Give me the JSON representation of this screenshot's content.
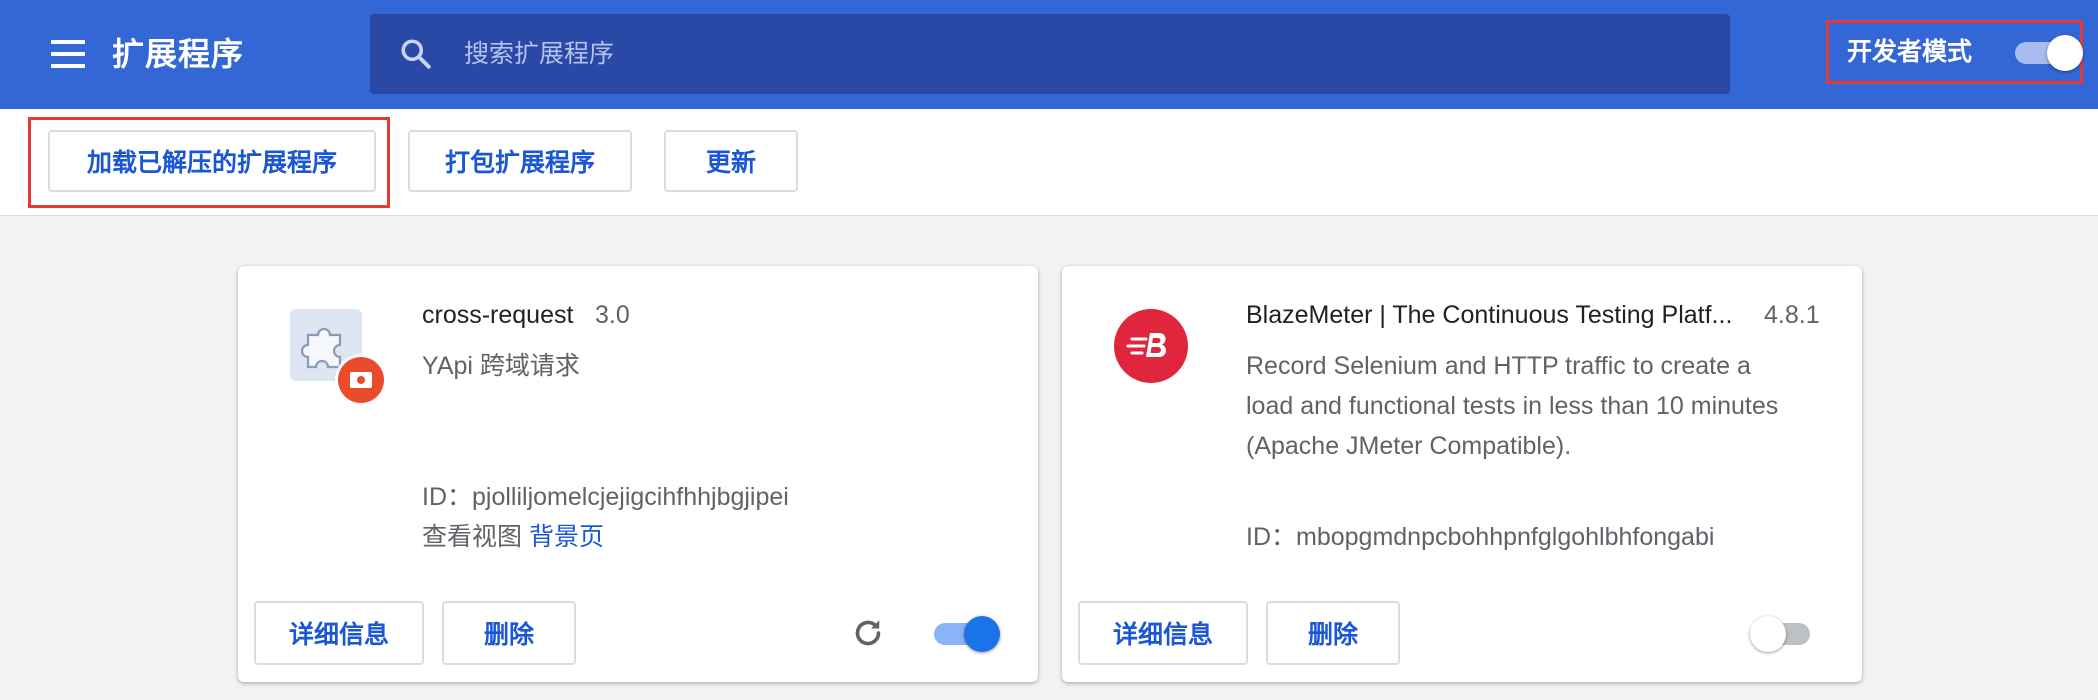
{
  "header": {
    "title": "扩展程序",
    "search_placeholder": "搜索扩展程序",
    "dev_mode_label": "开发者模式",
    "dev_mode_on": true
  },
  "toolbar": {
    "load_unpacked_label": "加载已解压的扩展程序",
    "pack_label": "打包扩展程序",
    "update_label": "更新"
  },
  "extensions": [
    {
      "name": "cross-request",
      "version": "3.0",
      "description": "YApi 跨域请求",
      "id_label": "ID：",
      "id": "pjolliljomelcjejigcihfhhjbgjipei",
      "views_label": "查看视图",
      "views_link": "背景页",
      "details_label": "详细信息",
      "remove_label": "删除",
      "enabled": true
    },
    {
      "name": "BlazeMeter | The Continuous Testing Platf...",
      "version": "4.8.1",
      "description_lines": [
        "Record Selenium and HTTP traffic to create a",
        "load and functional tests in less than 10 minutes",
        "(Apache JMeter Compatible)."
      ],
      "id_label": "ID：",
      "id": "mbopgmdnpcbohhpnfglgohlbhfongabi",
      "details_label": "详细信息",
      "remove_label": "删除",
      "enabled": false
    }
  ],
  "colors": {
    "header_bg": "#3367d6",
    "search_bg": "#2a48a5",
    "accent_blue": "#1a56d6",
    "highlight_red": "#e53935",
    "blazemeter_red": "#e0263c",
    "badge_orange": "#ea4b2a"
  },
  "icons": {
    "menu": "hamburger-menu-icon",
    "search": "search-icon",
    "reload": "reload-icon",
    "cross_request_logo": "puzzle-piece-icon",
    "blazemeter_logo": "blazemeter-logo-icon"
  }
}
